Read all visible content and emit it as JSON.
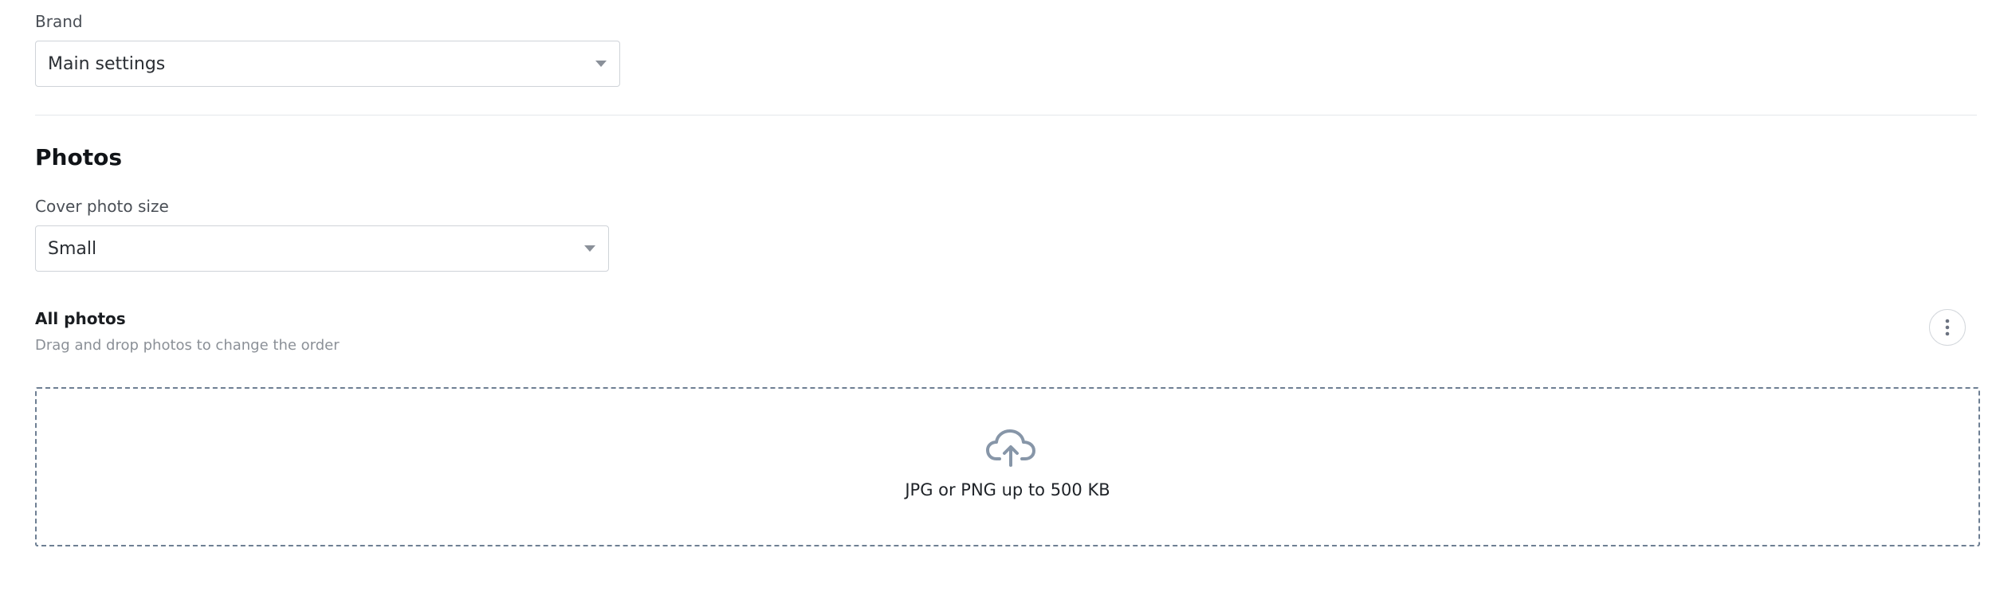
{
  "brand": {
    "label": "Brand",
    "value": "Main settings"
  },
  "photos": {
    "title": "Photos",
    "cover_size": {
      "label": "Cover photo size",
      "value": "Small"
    },
    "all_photos": {
      "title": "All photos",
      "hint": "Drag and drop photos to change the order",
      "more_icon": "more-vertical-icon"
    },
    "upload": {
      "icon": "cloud-upload-icon",
      "text": "JPG or PNG up to 500 KB"
    }
  },
  "colors": {
    "dropzone_border": "#6e7f93",
    "icon": "#8796a8"
  }
}
